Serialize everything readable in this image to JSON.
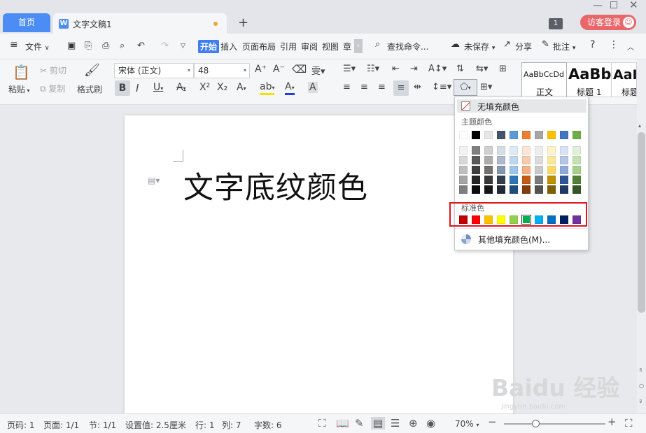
{
  "tabs": {
    "home": "首页",
    "document": "文字文稿1",
    "new_tab": "+"
  },
  "window": {
    "badge": "1",
    "login": "访客登录",
    "minimize": "—",
    "close": "✕"
  },
  "menu": {
    "file": "文件",
    "items": [
      "开始",
      "插入",
      "页面布局",
      "引用",
      "审阅",
      "视图",
      "章"
    ],
    "search": "查找命令...",
    "unsaved": "未保存",
    "share": "分享",
    "comment": "批注",
    "help": "?",
    "more": "⋮"
  },
  "ribbon": {
    "paste": "粘贴",
    "cut": "剪切",
    "copy": "复制",
    "format_painter": "格式刷",
    "font_name": "宋体 (正文)",
    "font_size": "48",
    "styles": [
      {
        "preview": "AaBbCcDd",
        "label": "正文"
      },
      {
        "preview": "AaBb",
        "label": "标题 1"
      },
      {
        "preview": "AaI",
        "label": "标题"
      }
    ]
  },
  "document": {
    "title": "文字底纹颜色"
  },
  "fill_popup": {
    "no_fill": "无填充颜色",
    "theme_label": "主题颜色",
    "standard_label": "标准色",
    "more": "其他填充颜色(M)...",
    "theme_top": [
      "#ffffff",
      "#000000",
      "#e7e6e6",
      "#44546a",
      "#5b9bd5",
      "#ed7d31",
      "#a5a5a5",
      "#ffc000",
      "#4472c4",
      "#70ad47"
    ],
    "theme_shades": [
      [
        "#f2f2f2",
        "#7f7f7f",
        "#d0cece",
        "#d6dce4",
        "#deebf6",
        "#fbe5d5",
        "#ededed",
        "#fff2cc",
        "#d9e2f3",
        "#e2efd9"
      ],
      [
        "#d8d8d8",
        "#595959",
        "#aeabab",
        "#adb9ca",
        "#bdd7ee",
        "#f7cbac",
        "#dbdbdb",
        "#fee599",
        "#b4c6e7",
        "#c5e0b3"
      ],
      [
        "#bfbfbf",
        "#3f3f3f",
        "#757070",
        "#8496b0",
        "#9dc3e6",
        "#f4b183",
        "#c9c9c9",
        "#ffd965",
        "#8eaadb",
        "#a8d08d"
      ],
      [
        "#a5a5a5",
        "#262626",
        "#3a3838",
        "#323f4f",
        "#2e75b5",
        "#c55a11",
        "#7b7b7b",
        "#bf9000",
        "#2f5496",
        "#538135"
      ],
      [
        "#7f7f7f",
        "#0c0c0c",
        "#171616",
        "#222a35",
        "#1e4e79",
        "#833c0b",
        "#525252",
        "#7f6000",
        "#1f3864",
        "#375623"
      ]
    ],
    "standard": [
      "#c00000",
      "#ff0000",
      "#ffc000",
      "#ffff00",
      "#92d050",
      "#00b050",
      "#00b0f0",
      "#0070c0",
      "#002060",
      "#7030a0"
    ]
  },
  "status": {
    "page_num": "页码: 1",
    "pages": "页面: 1/1",
    "section": "节: 1/1",
    "setting": "设置值: 2.5厘米",
    "row": "行: 1",
    "col": "列: 7",
    "chars": "字数: 6",
    "zoom": "70%"
  },
  "watermark": {
    "main": "Baidu 经验",
    "sub": "jingyan.baidu.com"
  }
}
